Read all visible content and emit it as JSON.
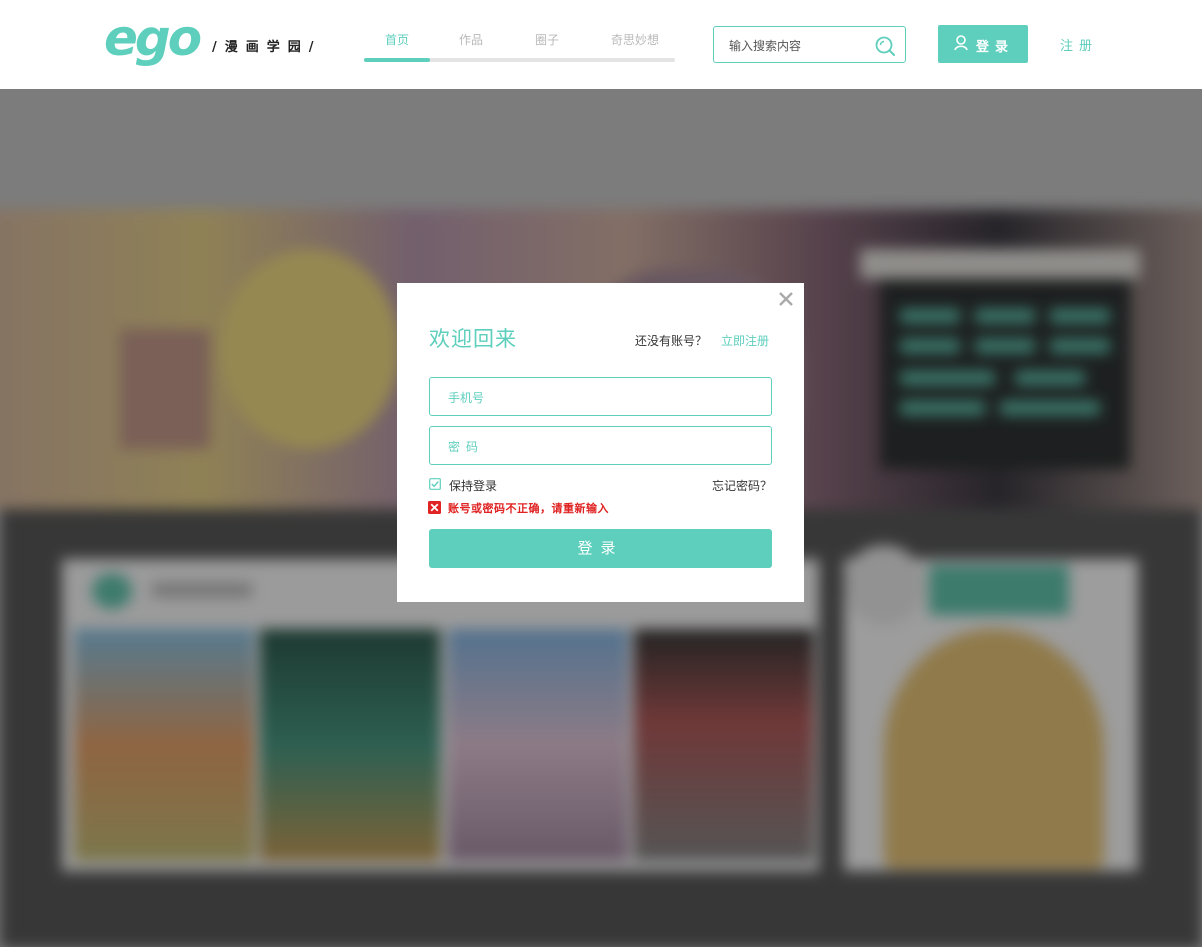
{
  "header": {
    "logo": "ego",
    "slogan": "/漫画学园/",
    "nav": [
      {
        "label": "首页",
        "active": true
      },
      {
        "label": "作品",
        "active": false
      },
      {
        "label": "圈子",
        "active": false
      },
      {
        "label": "奇思妙想",
        "active": false
      }
    ],
    "search": {
      "placeholder": "输入搜索内容"
    },
    "login_label": "登录",
    "register_label": "注册"
  },
  "modal": {
    "title": "欢迎回来",
    "no_account": "还没有账号？",
    "register_now": "立即注册",
    "phone_placeholder": "手机号",
    "password_placeholder": "密码",
    "remember_label": "保持登录",
    "remember_checked": true,
    "forgot_label": "忘记密码？",
    "error_message": "账号或密码不正确，请重新输入",
    "submit_label": "登录"
  },
  "colors": {
    "accent": "#5ecfbd",
    "error": "#e02323"
  },
  "icons": [
    "search-icon",
    "user-icon",
    "close-icon",
    "checkbox-checked-icon",
    "error-icon"
  ]
}
